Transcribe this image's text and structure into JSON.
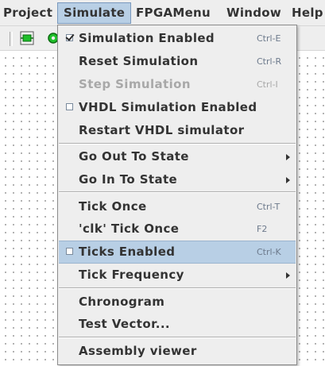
{
  "menubar": {
    "items": [
      {
        "label": "Project"
      },
      {
        "label": "Simulate"
      },
      {
        "label": "FPGAMenu"
      },
      {
        "label": "Window"
      },
      {
        "label": "Help"
      }
    ]
  },
  "toolbar": {
    "icons": [
      "green-component-icon",
      "green-gear-icon"
    ]
  },
  "simulate_menu": {
    "items": [
      {
        "label": "Simulation Enabled",
        "accel": "Ctrl-E",
        "checkbox": true,
        "checked": true
      },
      {
        "label": "Reset Simulation",
        "accel": "Ctrl-R"
      },
      {
        "label": "Step Simulation",
        "accel": "Ctrl-I",
        "disabled": true
      },
      {
        "label": "VHDL Simulation Enabled",
        "checkbox": true,
        "checked": false
      },
      {
        "label": "Restart VHDL simulator"
      },
      {
        "label": "Go Out To State",
        "submenu": true
      },
      {
        "label": "Go In To State",
        "submenu": true
      },
      {
        "label": "Tick Once",
        "accel": "Ctrl-T"
      },
      {
        "label": "'clk' Tick Once",
        "accel": "F2"
      },
      {
        "label": "Ticks Enabled",
        "accel": "Ctrl-K",
        "checkbox": true,
        "checked": false,
        "highlighted": true
      },
      {
        "label": "Tick Frequency",
        "submenu": true
      },
      {
        "label": "Chronogram"
      },
      {
        "label": "Test Vector..."
      },
      {
        "label": "Assembly viewer"
      }
    ]
  },
  "colors": {
    "highlight": "#b8cfe5",
    "menu_bg": "#eeeeee",
    "accelerator": "#6d7a8c",
    "disabled": "#a8a8a8"
  }
}
